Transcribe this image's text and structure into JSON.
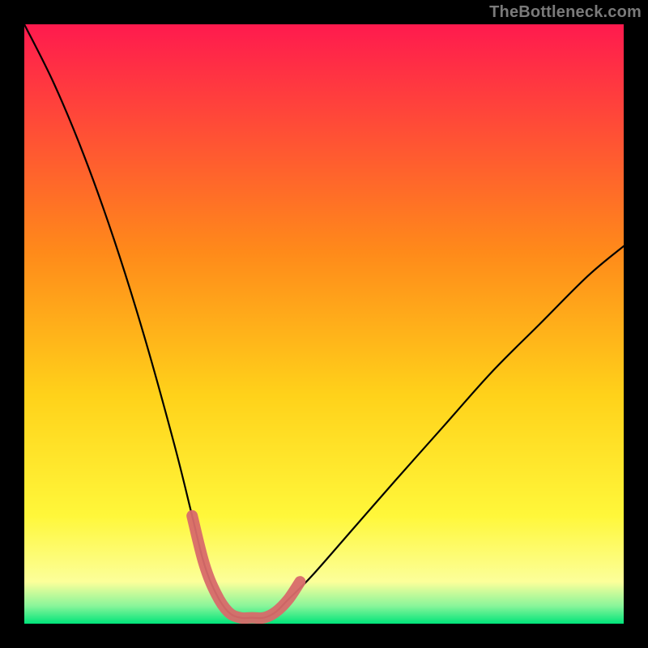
{
  "watermark": "TheBottleneck.com",
  "colors": {
    "bg": "#000000",
    "grad_top": "#ff1a4e",
    "grad_mid1": "#ff6a2a",
    "grad_mid2": "#ffd21a",
    "grad_mid3": "#fff73a",
    "grad_bottom": "#00e47a",
    "curve": "#000000",
    "overlay": "#d86a6a"
  },
  "chart_data": {
    "type": "line",
    "title": "",
    "xlabel": "",
    "ylabel": "",
    "xlim": [
      0,
      100
    ],
    "ylim": [
      0,
      100
    ],
    "series": [
      {
        "name": "bottleneck-curve",
        "x": [
          0,
          5,
          10,
          15,
          20,
          25,
          28,
          30,
          32,
          34,
          36,
          38,
          40,
          42,
          44,
          48,
          55,
          62,
          70,
          78,
          86,
          94,
          100
        ],
        "y": [
          100,
          90,
          78,
          64,
          48,
          30,
          18,
          10,
          5,
          2,
          1,
          1,
          1,
          2,
          4,
          8,
          16,
          24,
          33,
          42,
          50,
          58,
          63
        ]
      }
    ],
    "overlay_segment": {
      "name": "sweet-spot",
      "x": [
        28,
        30,
        32,
        34,
        36,
        38,
        40,
        42,
        44,
        46
      ],
      "y": [
        18,
        10,
        5,
        2,
        1,
        1,
        1,
        2,
        4,
        7
      ]
    },
    "gradient_bands": [
      {
        "y": 100,
        "color": "#ff1a4e"
      },
      {
        "y": 55,
        "color": "#ffb01a"
      },
      {
        "y": 30,
        "color": "#ffe81a"
      },
      {
        "y": 10,
        "color": "#fffb8a"
      },
      {
        "y": 2,
        "color": "#9af79a"
      },
      {
        "y": 0,
        "color": "#00e47a"
      }
    ]
  }
}
